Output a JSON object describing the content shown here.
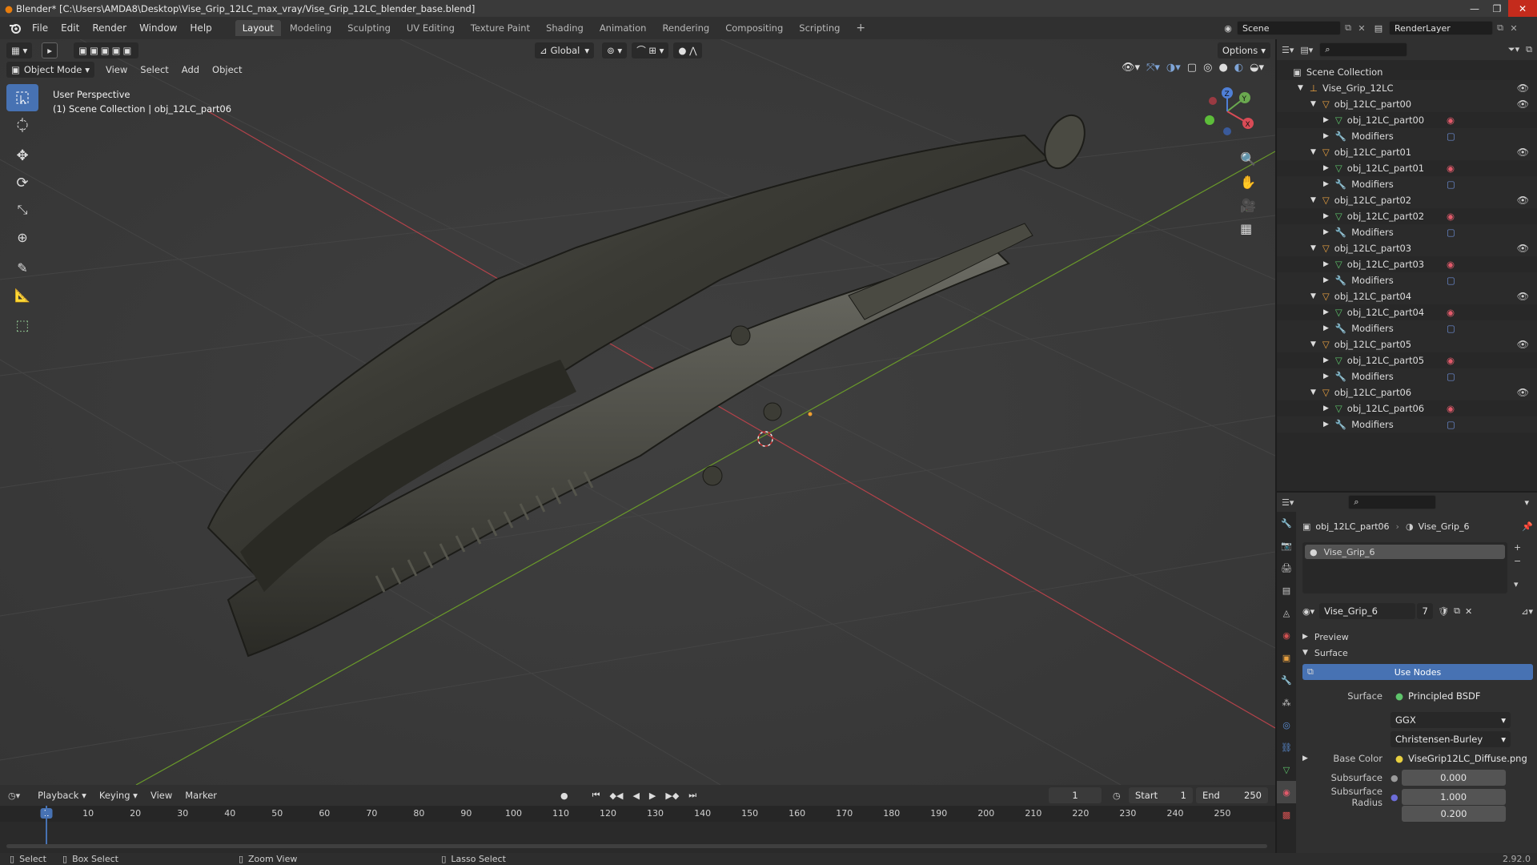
{
  "window": {
    "title": "Blender* [C:\\Users\\AMDA8\\Desktop\\Vise_Grip_12LC_max_vray/Vise_Grip_12LC_blender_base.blend]",
    "controls": [
      "—",
      "❐",
      "✕"
    ]
  },
  "menu": [
    "File",
    "Edit",
    "Render",
    "Window",
    "Help"
  ],
  "workspaces": [
    "Layout",
    "Modeling",
    "Sculpting",
    "UV Editing",
    "Texture Paint",
    "Shading",
    "Animation",
    "Rendering",
    "Compositing",
    "Scripting"
  ],
  "active_workspace": "Layout",
  "scene": {
    "name": "Scene",
    "render_layer": "RenderLayer"
  },
  "viewport": {
    "mode": "Object Mode",
    "header_menus": [
      "View",
      "Select",
      "Add",
      "Object"
    ],
    "transform_orientation": "Global",
    "options_label": "Options",
    "info_line1": "User Perspective",
    "info_line2": "(1) Scene Collection | obj_12LC_part06",
    "tools": [
      "select-box-icon",
      "cursor-icon",
      "move-icon",
      "rotate-icon",
      "scale-icon",
      "transform-icon",
      "annotate-icon",
      "measure-icon",
      "add-cube-icon"
    ],
    "gizmo": {
      "x": "X",
      "y": "Y",
      "z": "Z"
    },
    "accent": "#4772b3"
  },
  "outliner": {
    "root": "Scene Collection",
    "collection": "Vise_Grip_12LC",
    "objects": [
      {
        "name": "obj_12LC_part00",
        "mesh": "obj_12LC_part00",
        "modifiers": "Modifiers"
      },
      {
        "name": "obj_12LC_part01",
        "mesh": "obj_12LC_part01",
        "modifiers": "Modifiers"
      },
      {
        "name": "obj_12LC_part02",
        "mesh": "obj_12LC_part02",
        "modifiers": "Modifiers"
      },
      {
        "name": "obj_12LC_part03",
        "mesh": "obj_12LC_part03",
        "modifiers": "Modifiers"
      },
      {
        "name": "obj_12LC_part04",
        "mesh": "obj_12LC_part04",
        "modifiers": "Modifiers"
      },
      {
        "name": "obj_12LC_part05",
        "mesh": "obj_12LC_part05",
        "modifiers": "Modifiers"
      },
      {
        "name": "obj_12LC_part06",
        "mesh": "obj_12LC_part06",
        "modifiers": "Modifiers"
      }
    ]
  },
  "properties": {
    "object": "obj_12LC_part06",
    "material": "Vise_Grip_6",
    "slot_name": "Vise_Grip_6",
    "material_field": "Vise_Grip_6",
    "users": "7",
    "preview_label": "Preview",
    "surface_label": "Surface",
    "use_nodes_label": "Use Nodes",
    "surface_field_label": "Surface",
    "surface_value": "Principled BSDF",
    "distribution": "GGX",
    "subsurface_method": "Christensen-Burley",
    "base_color_label": "Base Color",
    "base_color_value": "ViseGrip12LC_Diffuse.png",
    "subsurface_label": "Subsurface",
    "subsurface_value": "0.000",
    "subsurface_radius_label": "Subsurface Radius",
    "subsurface_radius_1": "1.000",
    "subsurface_radius_2": "0.200"
  },
  "timeline": {
    "menus": [
      "Playback",
      "Keying",
      "View",
      "Marker"
    ],
    "current_frame": "1",
    "start_label": "Start",
    "start": "1",
    "end_label": "End",
    "end": "250",
    "ruler": [
      "1",
      "10",
      "20",
      "30",
      "40",
      "50",
      "60",
      "70",
      "80",
      "90",
      "100",
      "110",
      "120",
      "130",
      "140",
      "150",
      "160",
      "170",
      "180",
      "190",
      "200",
      "210",
      "220",
      "230",
      "240",
      "250"
    ]
  },
  "status": {
    "select": "Select",
    "box_select": "Box Select",
    "zoom_view": "Zoom View",
    "lasso_select": "Lasso Select",
    "version": "2.92.0"
  }
}
